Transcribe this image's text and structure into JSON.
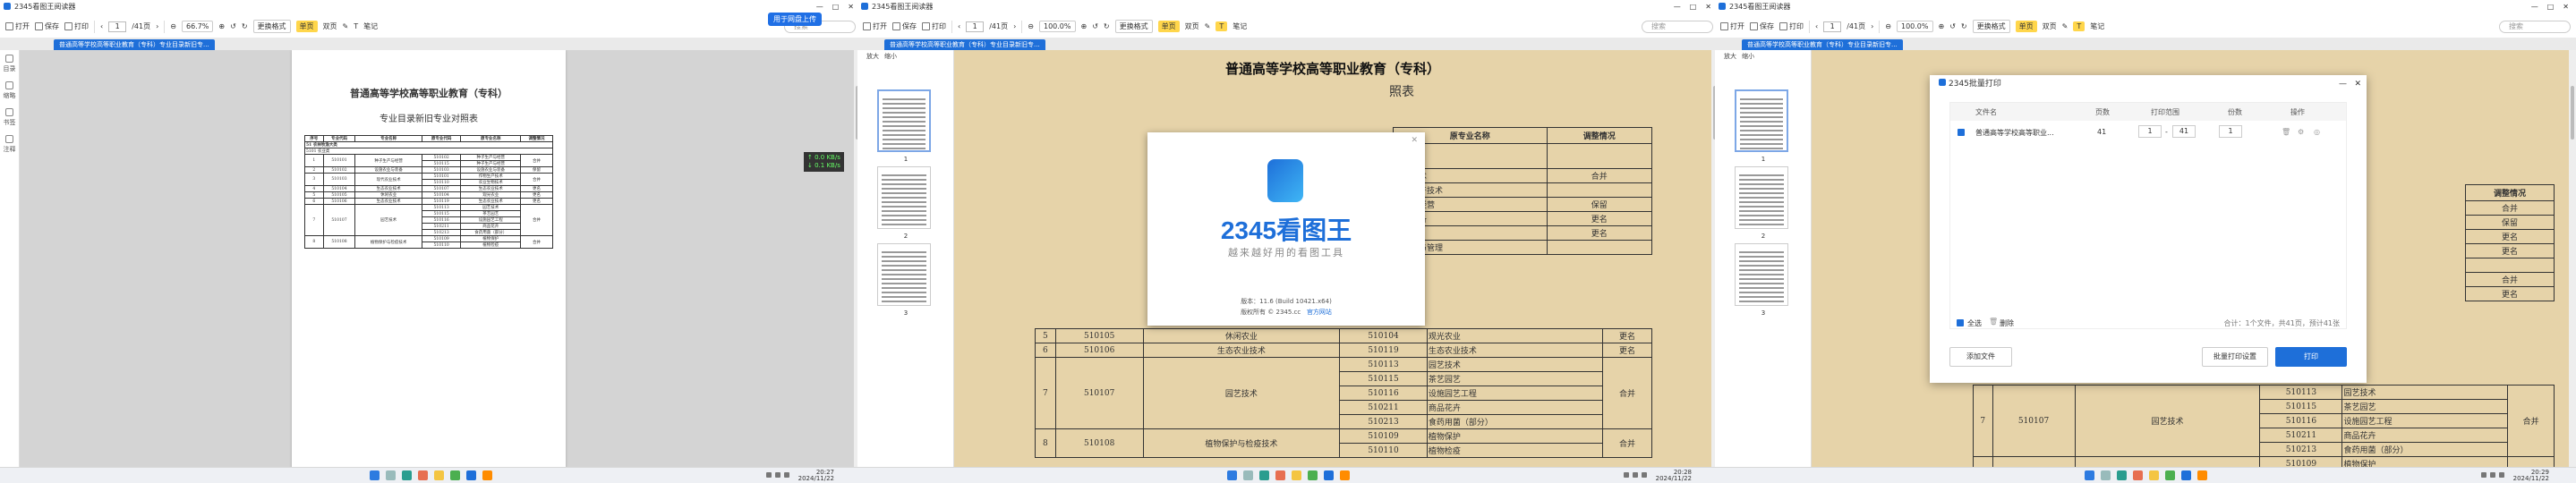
{
  "app": {
    "title": "2345看图王阅读器",
    "window_controls": [
      "—",
      "□",
      "✕"
    ]
  },
  "toolbar": {
    "open": "打开",
    "save": "保存",
    "print": "打印",
    "page_current": "1",
    "page_total": "/41页",
    "zoom_s1": "66.7%",
    "zoom_s2": "100.0%",
    "zoom_s3": "100.0%",
    "more_tools": "更换格式",
    "single_page": "单页",
    "double_page": "双页",
    "markup": "笔记",
    "search_placeholder": "搜索"
  },
  "tab": {
    "label": "普通高等学校高等职业教育（专科）专业目录新旧专..."
  },
  "sidebar": {
    "items": [
      {
        "label": "目录"
      },
      {
        "label": "缩略"
      },
      {
        "label": "书签"
      },
      {
        "label": "注释"
      }
    ]
  },
  "float_upload": "用于网盘上传",
  "net": {
    "up": "↑ 0.0 KB/s",
    "down": "↓ 0.1 KB/s"
  },
  "doc": {
    "title": "普通高等学校高等职业教育（专科）",
    "subtitle": "专业目录新旧专业对照表",
    "subtitle_partial": "照表",
    "headers": [
      "序号",
      "专业代码",
      "专业名称",
      "原专业代码",
      "原专业名称",
      "调整情况"
    ],
    "group": "51 农林牧渔大类",
    "subgroup": "5101 农业类",
    "rows": [
      {
        "no": "1",
        "code": "510101",
        "name": "种子生产与经营",
        "old_codes": [
          "510102",
          "510115"
        ],
        "old_names": [
          "种子生产与经营",
          "种子生产与经营"
        ],
        "adj": "合并"
      },
      {
        "no": "2",
        "code": "510102",
        "name": "设施农业与装备",
        "old_codes": [
          "510103"
        ],
        "old_names": [
          "设施农业与装备"
        ],
        "adj": "保留"
      },
      {
        "no": "3",
        "code": "510103",
        "name": "现代农业技术",
        "old_codes": [
          "510101",
          "510110"
        ],
        "old_names": [
          "作物生产技术",
          "农业生物技术"
        ],
        "adj": "合并"
      },
      {
        "no": "4",
        "code": "510104",
        "name": "生态农业技术",
        "old_codes": [
          "510107"
        ],
        "old_names": [
          "生态农业技术"
        ],
        "adj": "更名"
      },
      {
        "no": "5",
        "code": "510105",
        "name": "休闲农业",
        "old_codes": [
          "510104"
        ],
        "old_names": [
          "观光农业"
        ],
        "adj": "更名"
      },
      {
        "no": "6",
        "code": "510106",
        "name": "生态农业技术",
        "old_codes": [
          "510119"
        ],
        "old_names": [
          "生态农业技术"
        ],
        "adj": "更名"
      },
      {
        "no": "7",
        "code": "510107",
        "name": "园艺技术",
        "old_codes": [
          "510113",
          "510115",
          "510116",
          "510211",
          "510213"
        ],
        "old_names": [
          "园艺技术",
          "茶艺园艺",
          "设施园艺工程",
          "商品花卉",
          "食药用菌（部分）"
        ],
        "adj": "合并"
      },
      {
        "no": "8",
        "code": "510108",
        "name": "植物保护与检疫技术",
        "old_codes": [
          "510109",
          "510110"
        ],
        "old_names": [
          "植物保护",
          "植物检疫"
        ],
        "adj": "合并"
      }
    ],
    "right_rows": [
      {
        "text": "职业技术",
        "adj": "合并"
      },
      {
        "text": "植物生产技术",
        "adj": ""
      },
      {
        "text": "农产与经营",
        "adj": "保留"
      },
      {
        "text": "业与装备",
        "adj": "更名"
      },
      {
        "text": "业技术",
        "adj": "更名"
      },
      {
        "text": "业技术与管理",
        "adj": ""
      }
    ]
  },
  "thumbnails": {
    "enlarge": "放大",
    "shrink": "缩小",
    "pages": [
      "1",
      "2",
      "3"
    ]
  },
  "about": {
    "logo_text": "2345看图王",
    "slogan": "越来越好用的看图工具",
    "version": "版本：11.6 (Build 10421.x64)",
    "copyright": "版权所有 © 2345.cc",
    "link": "官方网站",
    "close": "✕"
  },
  "print_dialog": {
    "title": "2345批量打印",
    "col_file": "文件名",
    "col_pages": "页数",
    "col_range": "打印范围",
    "col_copies": "份数",
    "col_action": "操作",
    "file_name": "普通高等学校高等职业...",
    "pages": "41",
    "range_from": "1",
    "range_to": "41",
    "copies": "1",
    "select_all": "全选",
    "delete": "删除",
    "summary": "合计：1个文件，共41页，预计41张",
    "add_file": "添加文件",
    "batch_settings": "批量打印设置",
    "print": "打印"
  },
  "taskbar": {
    "clock1": {
      "time": "20:27",
      "date": "2024/11/22"
    },
    "clock2": {
      "time": "20:28",
      "date": "2024/11/22"
    },
    "clock3": {
      "time": "20:29",
      "date": "2024/11/22"
    }
  },
  "colors": {
    "accent": "#1e6fd9",
    "toolbar_yellow": "#ffd64b",
    "doc_bg": "#e6d3a9"
  }
}
